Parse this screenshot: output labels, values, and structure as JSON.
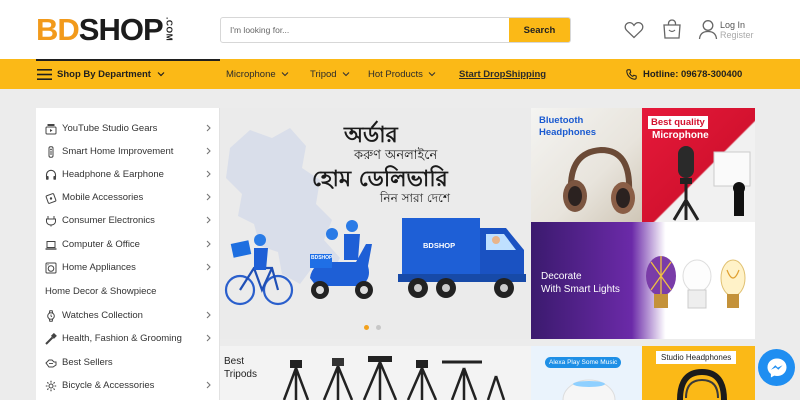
{
  "logo": {
    "bd": "BD",
    "shop": "SHOP",
    "com": ".COM"
  },
  "search": {
    "placeholder": "I'm looking for...",
    "button": "Search"
  },
  "account": {
    "login": "Log In",
    "register": "Register"
  },
  "nav": {
    "department": "Shop By Department",
    "links": [
      "Microphone",
      "Tripod",
      "Hot Products",
      "Start DropShipping"
    ],
    "hotline": "Hotline: 09678-300400"
  },
  "sidebar": {
    "items": [
      {
        "label": "YouTube Studio Gears",
        "icon": "youtube-icon",
        "chevron": true
      },
      {
        "label": "Smart Home Improvement",
        "icon": "smart-home-icon",
        "chevron": true
      },
      {
        "label": "Headphone & Earphone",
        "icon": "headphone-icon",
        "chevron": true
      },
      {
        "label": "Mobile Accessories",
        "icon": "mobile-icon",
        "chevron": true
      },
      {
        "label": "Consumer Electronics",
        "icon": "electronics-icon",
        "chevron": true
      },
      {
        "label": "Computer & Office",
        "icon": "laptop-icon",
        "chevron": true
      },
      {
        "label": "Home Appliances",
        "icon": "appliance-icon",
        "chevron": true
      },
      {
        "label": "Home Decor & Showpiece",
        "icon": "",
        "chevron": false
      },
      {
        "label": "Watches Collection",
        "icon": "watch-icon",
        "chevron": true
      },
      {
        "label": "Health, Fashion & Grooming",
        "icon": "grooming-icon",
        "chevron": true
      },
      {
        "label": "Best Sellers",
        "icon": "best-seller-icon",
        "chevron": false
      },
      {
        "label": "Bicycle & Accessories",
        "icon": "bicycle-icon",
        "chevron": true
      }
    ]
  },
  "hero": {
    "line1": "অর্ডার",
    "line2": "করুণ অনলাইনে",
    "line3": "হোম ডেলিভারি",
    "line4": "নিন সারা দেশে",
    "truck_brand": "BDSHOP",
    "scooter_brand": "BDSHOP",
    "slides": 2,
    "active_slide": 1
  },
  "promos": {
    "bluetooth": {
      "line1": "Bluetooth",
      "line2": "Headphones"
    },
    "microphone": {
      "line1": "Best quality",
      "line2": "Microphone"
    },
    "smartlights": {
      "line1": "Decorate",
      "line2": "With Smart Lights"
    },
    "tripods": {
      "line1": "Best",
      "line2": "Tripods"
    },
    "alexa": {
      "label": "Alexa Play Some Music"
    },
    "studio": {
      "label": "Studio Headphones"
    }
  },
  "colors": {
    "accent": "#fbb917",
    "logo_orange": "#f29a1b",
    "truck_blue": "#1e5fd6",
    "messenger": "#1f8ef1"
  }
}
